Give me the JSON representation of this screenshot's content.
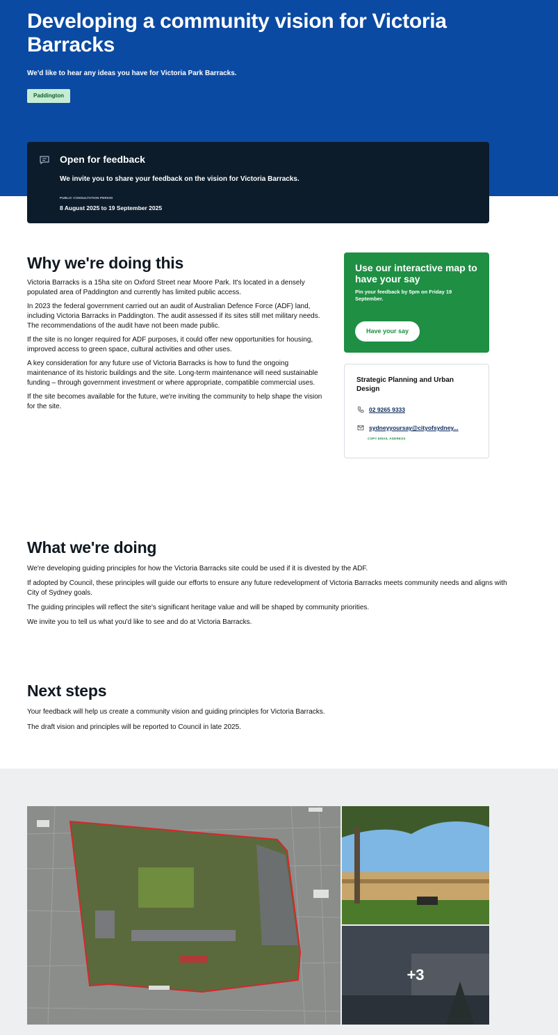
{
  "hero": {
    "title": "Developing a community vision for Victoria Barracks",
    "subtitle": "We'd like to hear any ideas you have for Victoria Park Barracks.",
    "tag": "Paddington"
  },
  "feedback": {
    "icon": "chat-icon",
    "title": "Open for feedback",
    "text": "We invite you to share your feedback on the vision for Victoria Barracks.",
    "period_label": "PUBLIC CONSULTATION PERIOD",
    "dates": "8 August 2025 to 19 September 2025"
  },
  "why": {
    "heading": "Why we're doing this",
    "paragraphs": [
      "Victoria Barracks is a 15ha site on Oxford Street near Moore Park. It's located in a densely populated area of Paddington and currently has limited public access.",
      "In 2023 the federal government carried out an audit of Australian Defence Force (ADF) land, including Victoria Barracks in Paddington. The audit assessed if its sites still met military needs. The recommendations of the audit have not been made public.",
      "If the site is no longer required for ADF purposes, it could offer new opportunities for housing, improved access to green space, cultural activities and other uses.",
      "A key consideration for any future use of Victoria Barracks is how to fund the ongoing maintenance of its historic buildings and the site. Long-term maintenance will need sustainable funding – through government investment or where appropriate, compatible commercial uses.",
      "If the site becomes available for the future, we're inviting the community to help shape the vision for the site."
    ]
  },
  "map_card": {
    "title": "Use our interactive map to have your say",
    "subtitle": "Pin your feedback by 5pm on Friday 19 September.",
    "button": "Have your say"
  },
  "contact": {
    "title": "Strategic Planning and Urban Design",
    "phone_icon": "phone-icon",
    "phone": "02 9265 9333",
    "email_icon": "email-icon",
    "email": "sydneyyoursay@cityofsydney...",
    "copy_label": "COPY EMAIL ADDRESS"
  },
  "what": {
    "heading": "What we're doing",
    "paragraphs": [
      "We're developing guiding principles for how the Victoria Barracks site could be used if it is divested by the ADF.",
      "If adopted by Council, these principles will guide our efforts to ensure any future redevelopment of Victoria Barracks meets community needs and aligns with City of Sydney goals.",
      "The guiding principles will reflect the site's significant heritage value and will be shaped by community priorities.",
      "We invite you to tell us what you'd like to see and do at Victoria Barracks."
    ]
  },
  "next": {
    "heading": "Next steps",
    "paragraphs": [
      "Your feedback will help us create a community vision and guiding principles for Victoria Barracks.",
      "The draft vision and principles will be reported to Council in late 2025."
    ]
  },
  "gallery": {
    "more_label": "+3"
  }
}
